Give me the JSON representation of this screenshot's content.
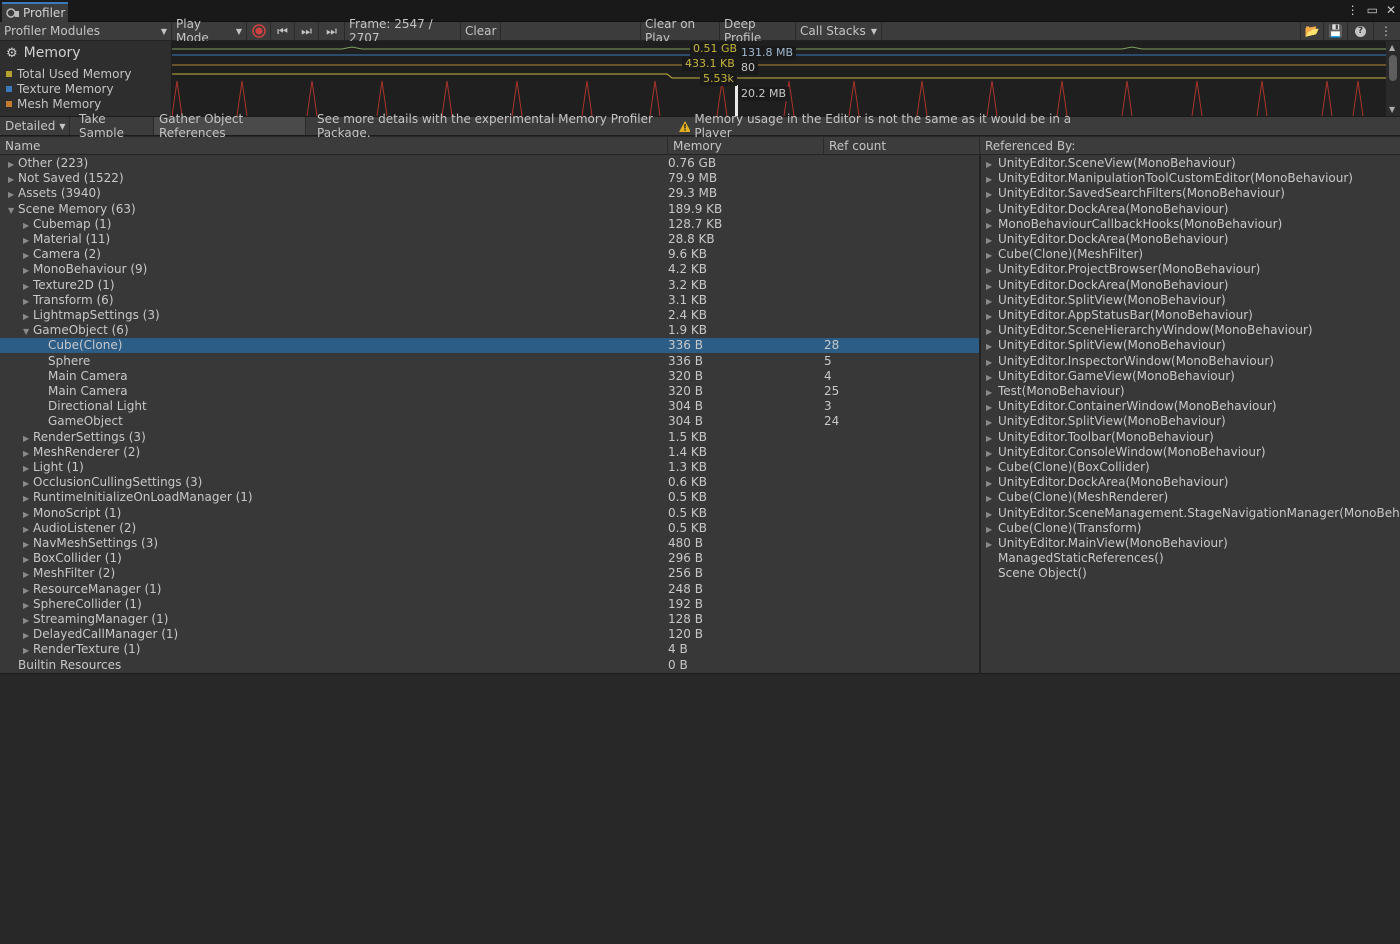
{
  "window": {
    "tab_title": "Profiler"
  },
  "toolbar": {
    "modules": "Profiler Modules",
    "play_mode": "Play Mode",
    "frame": "Frame: 2547 / 2707",
    "clear": "Clear",
    "clear_on_play": "Clear on Play",
    "deep_profile": "Deep Profile",
    "call_stacks": "Call Stacks"
  },
  "module": {
    "title": "Memory",
    "legend": [
      {
        "label": "Total Used Memory",
        "color": "#b4a12e"
      },
      {
        "label": "Texture Memory",
        "color": "#3a79bb"
      },
      {
        "label": "Mesh Memory",
        "color": "#c47b2e"
      }
    ]
  },
  "graph_tooltips": {
    "t1": "0.51 GB",
    "t2": "131.8 MB",
    "t3": "433.1 KB",
    "t4": "80",
    "t5": "5.53k",
    "t6": "20.2 MB"
  },
  "subbar": {
    "detailed": "Detailed",
    "take_sample": "Take Sample",
    "gather_refs": "Gather Object References",
    "info": "See more details with the experimental Memory Profiler Package.",
    "warning": "Memory usage in the Editor is not the same as it would be in a Player"
  },
  "columns": {
    "name": "Name",
    "memory": "Memory",
    "ref_count": "Ref count",
    "referenced_by": "Referenced By:"
  },
  "rows": [
    {
      "name": "Other (223)",
      "memory": "0.76 GB",
      "refs": "",
      "level": 0,
      "arrow": "right"
    },
    {
      "name": "Not Saved (1522)",
      "memory": "79.9 MB",
      "refs": "",
      "level": 0,
      "arrow": "right"
    },
    {
      "name": "Assets (3940)",
      "memory": "29.3 MB",
      "refs": "",
      "level": 0,
      "arrow": "right"
    },
    {
      "name": "Scene Memory (63)",
      "memory": "189.9 KB",
      "refs": "",
      "level": 0,
      "arrow": "down"
    },
    {
      "name": "Cubemap (1)",
      "memory": "128.7 KB",
      "refs": "",
      "level": 1,
      "arrow": "right"
    },
    {
      "name": "Material (11)",
      "memory": "28.8 KB",
      "refs": "",
      "level": 1,
      "arrow": "right"
    },
    {
      "name": "Camera (2)",
      "memory": "9.6 KB",
      "refs": "",
      "level": 1,
      "arrow": "right"
    },
    {
      "name": "MonoBehaviour (9)",
      "memory": "4.2 KB",
      "refs": "",
      "level": 1,
      "arrow": "right"
    },
    {
      "name": "Texture2D (1)",
      "memory": "3.2 KB",
      "refs": "",
      "level": 1,
      "arrow": "right"
    },
    {
      "name": "Transform (6)",
      "memory": "3.1 KB",
      "refs": "",
      "level": 1,
      "arrow": "right"
    },
    {
      "name": "LightmapSettings (3)",
      "memory": "2.4 KB",
      "refs": "",
      "level": 1,
      "arrow": "right"
    },
    {
      "name": "GameObject (6)",
      "memory": "1.9 KB",
      "refs": "",
      "level": 1,
      "arrow": "down"
    },
    {
      "name": "Cube(Clone)",
      "memory": "336 B",
      "refs": "28",
      "level": 2,
      "arrow": "",
      "selected": true
    },
    {
      "name": "Sphere",
      "memory": "336 B",
      "refs": "5",
      "level": 2,
      "arrow": ""
    },
    {
      "name": "Main Camera",
      "memory": "320 B",
      "refs": "4",
      "level": 2,
      "arrow": ""
    },
    {
      "name": "Main Camera",
      "memory": "320 B",
      "refs": "25",
      "level": 2,
      "arrow": ""
    },
    {
      "name": "Directional Light",
      "memory": "304 B",
      "refs": "3",
      "level": 2,
      "arrow": ""
    },
    {
      "name": "GameObject",
      "memory": "304 B",
      "refs": "24",
      "level": 2,
      "arrow": ""
    },
    {
      "name": "RenderSettings (3)",
      "memory": "1.5 KB",
      "refs": "",
      "level": 1,
      "arrow": "right"
    },
    {
      "name": "MeshRenderer (2)",
      "memory": "1.4 KB",
      "refs": "",
      "level": 1,
      "arrow": "right"
    },
    {
      "name": "Light (1)",
      "memory": "1.3 KB",
      "refs": "",
      "level": 1,
      "arrow": "right"
    },
    {
      "name": "OcclusionCullingSettings (3)",
      "memory": "0.6 KB",
      "refs": "",
      "level": 1,
      "arrow": "right"
    },
    {
      "name": "RuntimeInitializeOnLoadManager (1)",
      "memory": "0.5 KB",
      "refs": "",
      "level": 1,
      "arrow": "right"
    },
    {
      "name": "MonoScript (1)",
      "memory": "0.5 KB",
      "refs": "",
      "level": 1,
      "arrow": "right"
    },
    {
      "name": "AudioListener (2)",
      "memory": "0.5 KB",
      "refs": "",
      "level": 1,
      "arrow": "right"
    },
    {
      "name": "NavMeshSettings (3)",
      "memory": "480 B",
      "refs": "",
      "level": 1,
      "arrow": "right"
    },
    {
      "name": "BoxCollider (1)",
      "memory": "296 B",
      "refs": "",
      "level": 1,
      "arrow": "right"
    },
    {
      "name": "MeshFilter (2)",
      "memory": "256 B",
      "refs": "",
      "level": 1,
      "arrow": "right"
    },
    {
      "name": "ResourceManager (1)",
      "memory": "248 B",
      "refs": "",
      "level": 1,
      "arrow": "right"
    },
    {
      "name": "SphereCollider (1)",
      "memory": "192 B",
      "refs": "",
      "level": 1,
      "arrow": "right"
    },
    {
      "name": "StreamingManager (1)",
      "memory": "128 B",
      "refs": "",
      "level": 1,
      "arrow": "right"
    },
    {
      "name": "DelayedCallManager (1)",
      "memory": "120 B",
      "refs": "",
      "level": 1,
      "arrow": "right"
    },
    {
      "name": "RenderTexture (1)",
      "memory": "4 B",
      "refs": "",
      "level": 1,
      "arrow": "right"
    },
    {
      "name": "Builtin Resources",
      "memory": "0 B",
      "refs": "",
      "level": 0,
      "arrow": ""
    }
  ],
  "referenced_by": [
    {
      "label": "UnityEditor.SceneView(MonoBehaviour)",
      "arrow": true
    },
    {
      "label": "UnityEditor.ManipulationToolCustomEditor(MonoBehaviour)",
      "arrow": true
    },
    {
      "label": "UnityEditor.SavedSearchFilters(MonoBehaviour)",
      "arrow": true
    },
    {
      "label": "UnityEditor.DockArea(MonoBehaviour)",
      "arrow": true
    },
    {
      "label": "MonoBehaviourCallbackHooks(MonoBehaviour)",
      "arrow": true
    },
    {
      "label": "UnityEditor.DockArea(MonoBehaviour)",
      "arrow": true
    },
    {
      "label": "Cube(Clone)(MeshFilter)",
      "arrow": true
    },
    {
      "label": "UnityEditor.ProjectBrowser(MonoBehaviour)",
      "arrow": true
    },
    {
      "label": "UnityEditor.DockArea(MonoBehaviour)",
      "arrow": true
    },
    {
      "label": "UnityEditor.SplitView(MonoBehaviour)",
      "arrow": true
    },
    {
      "label": "UnityEditor.AppStatusBar(MonoBehaviour)",
      "arrow": true
    },
    {
      "label": "UnityEditor.SceneHierarchyWindow(MonoBehaviour)",
      "arrow": true
    },
    {
      "label": "UnityEditor.SplitView(MonoBehaviour)",
      "arrow": true
    },
    {
      "label": "UnityEditor.InspectorWindow(MonoBehaviour)",
      "arrow": true
    },
    {
      "label": "UnityEditor.GameView(MonoBehaviour)",
      "arrow": true
    },
    {
      "label": "Test(MonoBehaviour)",
      "arrow": true
    },
    {
      "label": "UnityEditor.ContainerWindow(MonoBehaviour)",
      "arrow": true
    },
    {
      "label": "UnityEditor.SplitView(MonoBehaviour)",
      "arrow": true
    },
    {
      "label": "UnityEditor.Toolbar(MonoBehaviour)",
      "arrow": true
    },
    {
      "label": "UnityEditor.ConsoleWindow(MonoBehaviour)",
      "arrow": true
    },
    {
      "label": "Cube(Clone)(BoxCollider)",
      "arrow": true
    },
    {
      "label": "UnityEditor.DockArea(MonoBehaviour)",
      "arrow": true
    },
    {
      "label": "Cube(Clone)(MeshRenderer)",
      "arrow": true
    },
    {
      "label": "UnityEditor.SceneManagement.StageNavigationManager(MonoBehaviour)",
      "arrow": true
    },
    {
      "label": "Cube(Clone)(Transform)",
      "arrow": true
    },
    {
      "label": "UnityEditor.MainView(MonoBehaviour)",
      "arrow": true
    },
    {
      "label": "ManagedStaticReferences()",
      "arrow": false
    },
    {
      "label": "Scene Object()",
      "arrow": false
    }
  ]
}
